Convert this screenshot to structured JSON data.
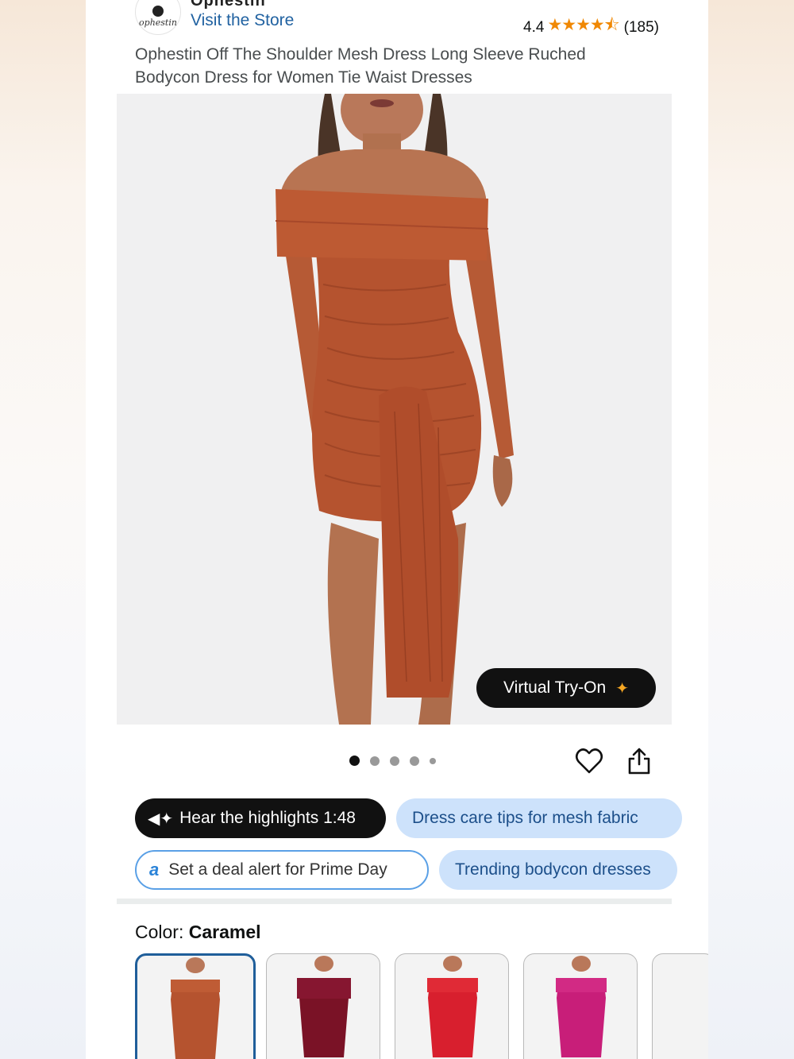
{
  "brand": {
    "name": "Ophestin",
    "logo_text": "ophestin",
    "visit_store": "Visit the Store",
    "rating_value": "4.4",
    "rating_stars": 4.4,
    "rating_count": "(185)"
  },
  "product": {
    "title": "Ophestin Off The Shoulder Mesh Dress Long Sleeve Ruched Bodycon Dress for Women Tie Waist Dresses"
  },
  "gallery": {
    "virtual_tryon_label": "Virtual Try-On",
    "image_count": 5,
    "active_index": 0
  },
  "chips": {
    "hear_highlights": "Hear the highlights 1:48",
    "care_tips": "Dress care tips for mesh fabric",
    "deal_alert": "Set a deal alert for Prime Day",
    "trending": "Trending bodycon dresses"
  },
  "color": {
    "label": "Color:",
    "selected": "Caramel",
    "swatches": [
      {
        "color": "#b5532f"
      },
      {
        "color": "#7a1226"
      },
      {
        "color": "#d81f2e"
      },
      {
        "color": "#c81e79"
      }
    ]
  },
  "colors": {
    "link": "#2162a1",
    "star": "#f08804",
    "chip_blue_bg": "#cde2fb",
    "selected_border": "#1f5e9a"
  }
}
